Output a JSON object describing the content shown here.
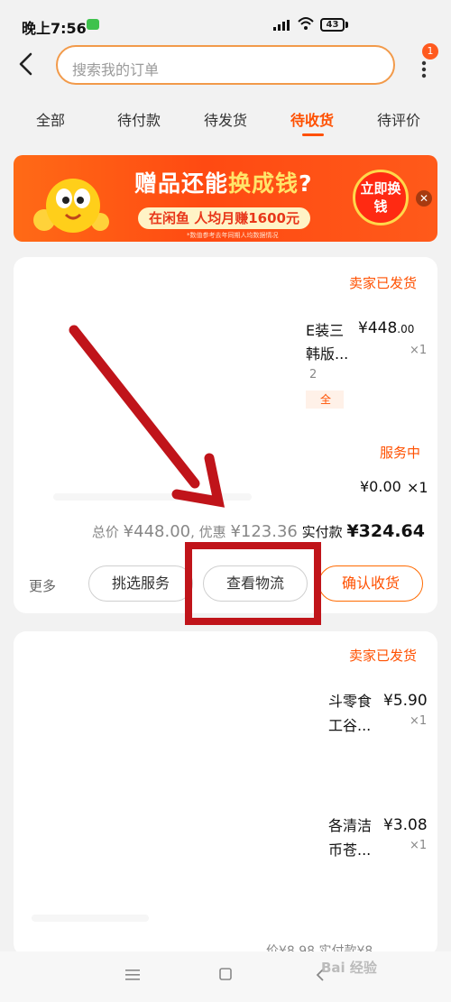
{
  "status_bar": {
    "time": "晚上7:56",
    "battery": "43"
  },
  "search": {
    "placeholder": "搜索我的订单"
  },
  "notification_count": "1",
  "tabs": [
    {
      "label": "全部"
    },
    {
      "label": "待付款"
    },
    {
      "label": "待发货"
    },
    {
      "label": "待收货",
      "active": true
    },
    {
      "label": "待评价"
    }
  ],
  "banner": {
    "title_a": "赠品还能",
    "title_b": "换成钱",
    "title_c": "?",
    "subtitle": "在闲鱼 人均月赚1600元",
    "note": "*数值参考去年同期人均数据情况",
    "cta": "立即换钱"
  },
  "orders": [
    {
      "status": "卖家已发货",
      "items": [
        {
          "title_1": "E装三",
          "title_2": "韩版...",
          "spec": "2",
          "tag": "全",
          "price_int": "¥448",
          "price_dec": ".00",
          "qty": "×1"
        },
        {
          "status": "服务中",
          "price_int": "¥0.00",
          "qty": "×1"
        }
      ],
      "total_label": "总价",
      "total_value": "¥448.00",
      "discount_label": ", 优惠",
      "discount_value": "¥123.36",
      "paid_label": "实付款",
      "paid_value": "¥324.64",
      "more": "更多",
      "actions": [
        "挑选服务",
        "查看物流",
        "确认收货"
      ]
    },
    {
      "status": "卖家已发货",
      "items": [
        {
          "title_1": "斗零食",
          "title_2": "工谷...",
          "price_int": "¥5.90",
          "qty": "×1"
        },
        {
          "title_1": "各清洁",
          "title_2": "币苍...",
          "price_int": "¥3.08",
          "qty": "×1"
        }
      ],
      "partial_total": "价¥8.98 实付款¥8"
    }
  ],
  "watermark": "Bai 经验",
  "colors": {
    "accent": "#ff5000",
    "annotation": "#c0141a"
  }
}
